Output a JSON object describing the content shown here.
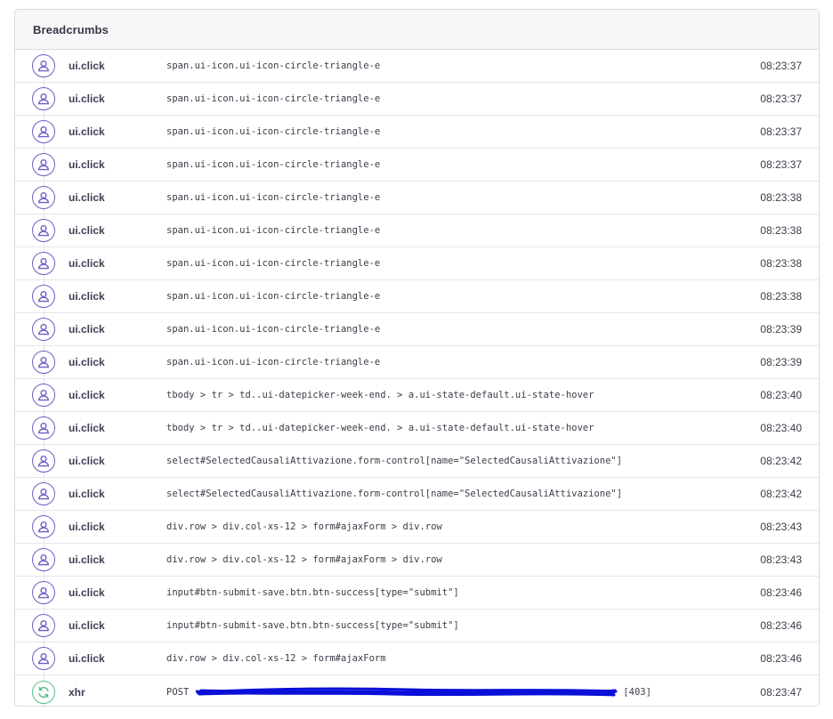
{
  "panel": {
    "title": "Breadcrumbs"
  },
  "colors": {
    "ui_icon": "#6c5fc7",
    "xhr_icon": "#57be8c",
    "redaction": "#0a10d8"
  },
  "crumbs": [
    {
      "category": "ui.click",
      "message": "span.ui-icon.ui-icon-circle-triangle-e",
      "time": "08:23:37",
      "icon": "user-icon"
    },
    {
      "category": "ui.click",
      "message": "span.ui-icon.ui-icon-circle-triangle-e",
      "time": "08:23:37",
      "icon": "user-icon"
    },
    {
      "category": "ui.click",
      "message": "span.ui-icon.ui-icon-circle-triangle-e",
      "time": "08:23:37",
      "icon": "user-icon"
    },
    {
      "category": "ui.click",
      "message": "span.ui-icon.ui-icon-circle-triangle-e",
      "time": "08:23:37",
      "icon": "user-icon"
    },
    {
      "category": "ui.click",
      "message": "span.ui-icon.ui-icon-circle-triangle-e",
      "time": "08:23:38",
      "icon": "user-icon"
    },
    {
      "category": "ui.click",
      "message": "span.ui-icon.ui-icon-circle-triangle-e",
      "time": "08:23:38",
      "icon": "user-icon"
    },
    {
      "category": "ui.click",
      "message": "span.ui-icon.ui-icon-circle-triangle-e",
      "time": "08:23:38",
      "icon": "user-icon"
    },
    {
      "category": "ui.click",
      "message": "span.ui-icon.ui-icon-circle-triangle-e",
      "time": "08:23:38",
      "icon": "user-icon"
    },
    {
      "category": "ui.click",
      "message": "span.ui-icon.ui-icon-circle-triangle-e",
      "time": "08:23:39",
      "icon": "user-icon"
    },
    {
      "category": "ui.click",
      "message": "span.ui-icon.ui-icon-circle-triangle-e",
      "time": "08:23:39",
      "icon": "user-icon"
    },
    {
      "category": "ui.click",
      "message": "tbody > tr > td..ui-datepicker-week-end. > a.ui-state-default.ui-state-hover",
      "time": "08:23:40",
      "icon": "user-icon"
    },
    {
      "category": "ui.click",
      "message": "tbody > tr > td..ui-datepicker-week-end. > a.ui-state-default.ui-state-hover",
      "time": "08:23:40",
      "icon": "user-icon"
    },
    {
      "category": "ui.click",
      "message": "select#SelectedCausaliAttivazione.form-control[name=\"SelectedCausaliAttivazione\"]",
      "time": "08:23:42",
      "icon": "user-icon"
    },
    {
      "category": "ui.click",
      "message": "select#SelectedCausaliAttivazione.form-control[name=\"SelectedCausaliAttivazione\"]",
      "time": "08:23:42",
      "icon": "user-icon"
    },
    {
      "category": "ui.click",
      "message": "div.row > div.col-xs-12 > form#ajaxForm > div.row",
      "time": "08:23:43",
      "icon": "user-icon"
    },
    {
      "category": "ui.click",
      "message": "div.row > div.col-xs-12 > form#ajaxForm > div.row",
      "time": "08:23:43",
      "icon": "user-icon"
    },
    {
      "category": "ui.click",
      "message": "input#btn-submit-save.btn.btn-success[type=\"submit\"]",
      "time": "08:23:46",
      "icon": "user-icon"
    },
    {
      "category": "ui.click",
      "message": "input#btn-submit-save.btn.btn-success[type=\"submit\"]",
      "time": "08:23:46",
      "icon": "user-icon"
    },
    {
      "category": "ui.click",
      "message": "div.row > div.col-xs-12 > form#ajaxForm",
      "time": "08:23:46",
      "icon": "user-icon"
    }
  ],
  "xhr_crumb": {
    "category": "xhr",
    "method": "POST",
    "status": "[403]",
    "time": "08:23:47",
    "icon": "refresh-icon"
  }
}
